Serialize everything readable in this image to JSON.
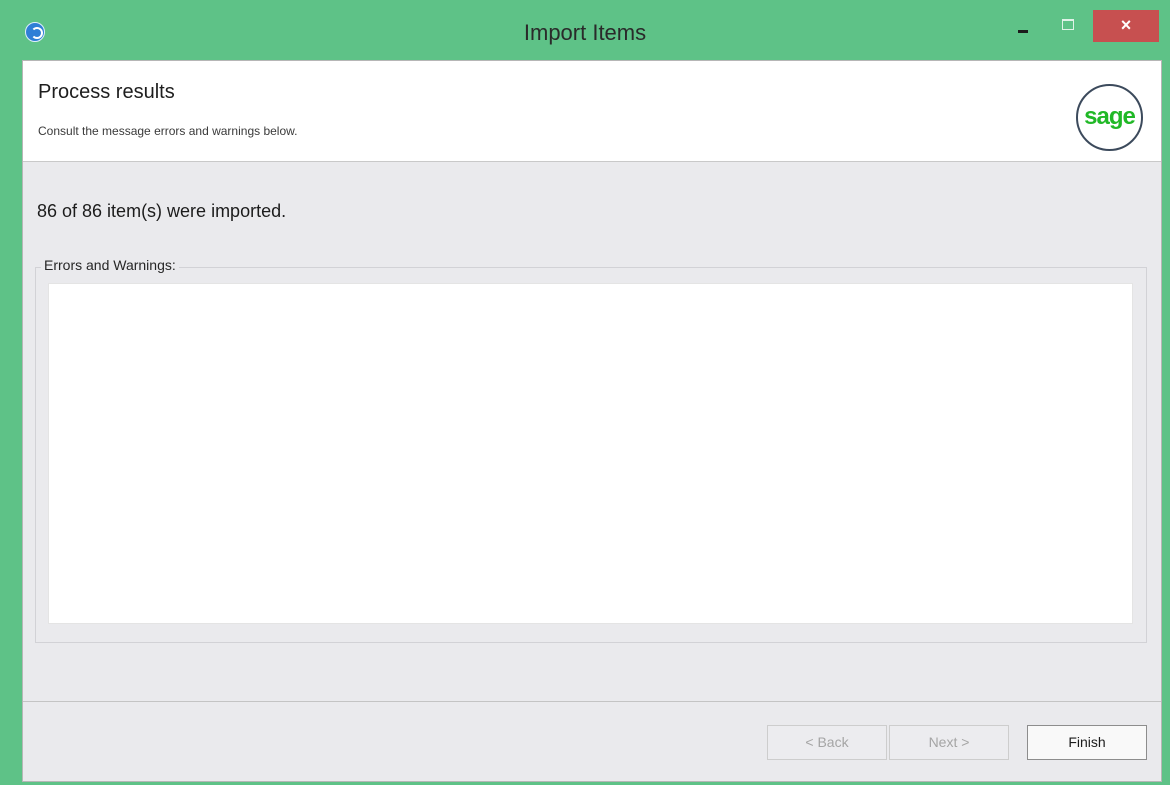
{
  "window": {
    "title": "Import Items",
    "app_icon": "app-icon",
    "controls": {
      "minimize": "minimize-icon",
      "maximize": "maximize-icon",
      "close_label": "×"
    },
    "colors": {
      "frame": "#5ec287",
      "close": "#c75050"
    }
  },
  "header": {
    "title": "Process results",
    "subtitle": "Consult the message errors and warnings below.",
    "logo_text": "sage",
    "logo_color": "#20b826"
  },
  "main": {
    "summary": "86 of 86 item(s) were imported.",
    "errors_group_label": "Errors and Warnings:",
    "messages": []
  },
  "footer": {
    "back_label": "< Back",
    "next_label": "Next >",
    "finish_label": "Finish"
  }
}
